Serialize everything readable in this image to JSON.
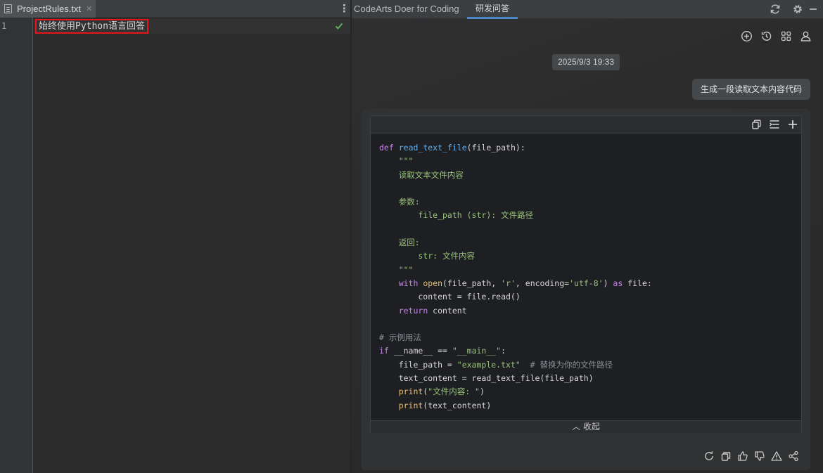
{
  "editor": {
    "tab_name": "ProjectRules.txt",
    "tab_close": "✕",
    "line_number": "1",
    "rule_text": "始终使用Python语言回答"
  },
  "panel": {
    "tabs": [
      {
        "label": "CodeArts Doer for Coding"
      },
      {
        "label": "研发问答"
      }
    ]
  },
  "chat": {
    "timestamp": "2025/9/3 19:33",
    "user_message": "生成一段读取文本内容代码",
    "collapse_label": "收起"
  },
  "colors": {
    "accent": "#4a88c7",
    "highlight_border": "#e8141c",
    "check": "#5fb15f"
  }
}
